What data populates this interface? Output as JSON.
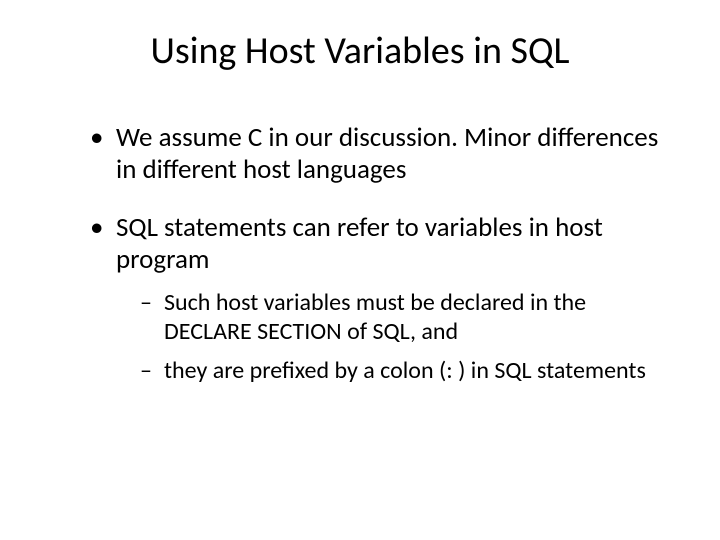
{
  "title": "Using Host Variables in SQL",
  "bullets": [
    {
      "text": "We assume C in our discussion.  Minor differences in different host languages",
      "children": []
    },
    {
      "text": "SQL statements can refer to variables in host program",
      "children": [
        {
          "text": "Such host variables must be declared in the DECLARE SECTION of SQL, and"
        },
        {
          "text": "they are prefixed by a colon (: ) in SQL statements"
        }
      ]
    }
  ]
}
